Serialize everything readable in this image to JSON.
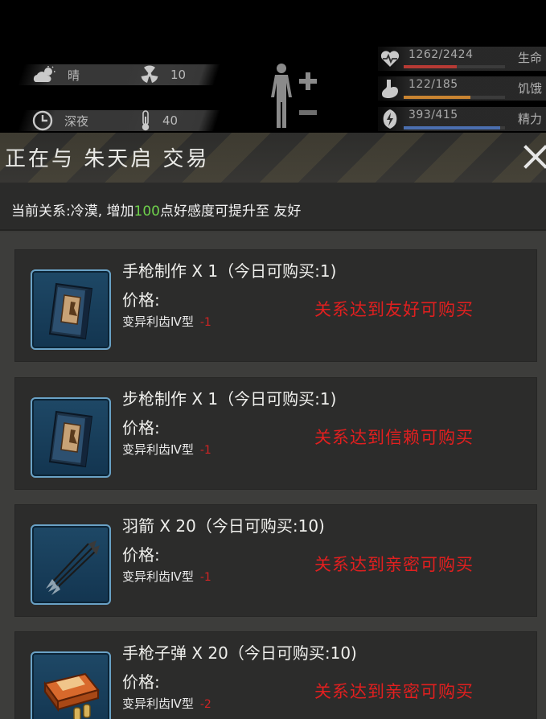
{
  "hud": {
    "weather": "晴",
    "radiation": "10",
    "time_of_day": "深夜",
    "temperature": "40",
    "icons": [
      "cloud-sun-icon",
      "radiation-icon",
      "clock-icon",
      "thermometer-icon",
      "body-icon",
      "plus-icon",
      "minus-icon"
    ]
  },
  "stats": [
    {
      "name": "生命",
      "value": "1262/2424",
      "fraction": 0.52,
      "color": "#b63a34",
      "icon": "heart-pulse-icon"
    },
    {
      "name": "饥饿",
      "value": "122/185",
      "fraction": 0.66,
      "color": "#c98431",
      "icon": "stomach-icon"
    },
    {
      "name": "精力",
      "value": "393/415",
      "fraction": 0.95,
      "color": "#4b6fb0",
      "icon": "energy-icon"
    }
  ],
  "trade": {
    "title": "正在与 朱天启 交易",
    "relation_prefix": "当前关系:冷漠, 增加",
    "relation_points": "100",
    "relation_suffix": "点好感度可提升至 友好",
    "accent_green": "#6fd24c",
    "lock_color": "#e21f1f"
  },
  "items": [
    {
      "name": "手枪制作 X 1（今日可购买:1)",
      "price_label": "价格:",
      "currency": "变异利齿Ⅳ型",
      "cost": "-1",
      "requirement": "关系达到友好可购买",
      "icon": "blueprint-book-icon"
    },
    {
      "name": "步枪制作 X 1（今日可购买:1)",
      "price_label": "价格:",
      "currency": "变异利齿Ⅳ型",
      "cost": "-1",
      "requirement": "关系达到信赖可购买",
      "icon": "blueprint-book-icon"
    },
    {
      "name": "羽箭 X 20（今日可购买:10)",
      "price_label": "价格:",
      "currency": "变异利齿Ⅳ型",
      "cost": "-1",
      "requirement": "关系达到亲密可购买",
      "icon": "arrows-icon"
    },
    {
      "name": "手枪子弹 X 20（今日可购买:10)",
      "price_label": "价格:",
      "currency": "变异利齿Ⅳ型",
      "cost": "-2",
      "requirement": "关系达到亲密可购买",
      "icon": "ammo-box-icon"
    }
  ]
}
